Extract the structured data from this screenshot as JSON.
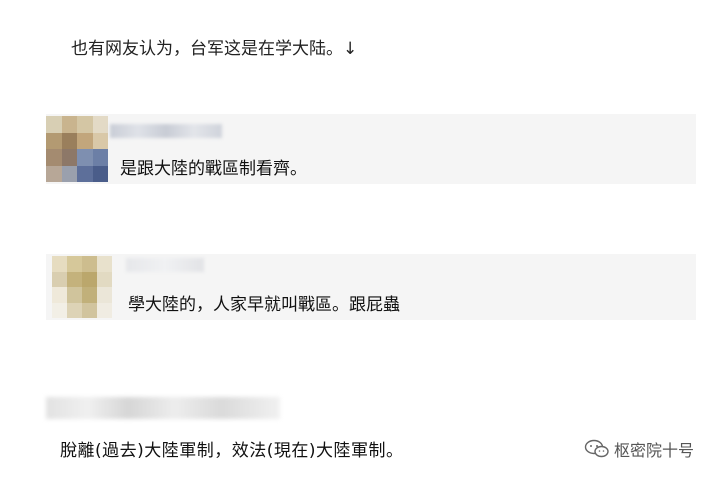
{
  "intro": "也有网友认为，台军这是在学大陆。↓",
  "comments": [
    {
      "text": "是跟大陸的戰區制看齊。"
    },
    {
      "text": "學大陸的，人家早就叫戰區。跟屁蟲"
    }
  ],
  "comment3": {
    "text": "脫離(過去)大陸軍制，效法(現在)大陸軍制。"
  },
  "watermark": {
    "label": "枢密院十号",
    "icon": "wechat-icon"
  },
  "colors": {
    "comment_bg": "#f5f5f5",
    "text": "#111111",
    "watermark": "#555555"
  }
}
